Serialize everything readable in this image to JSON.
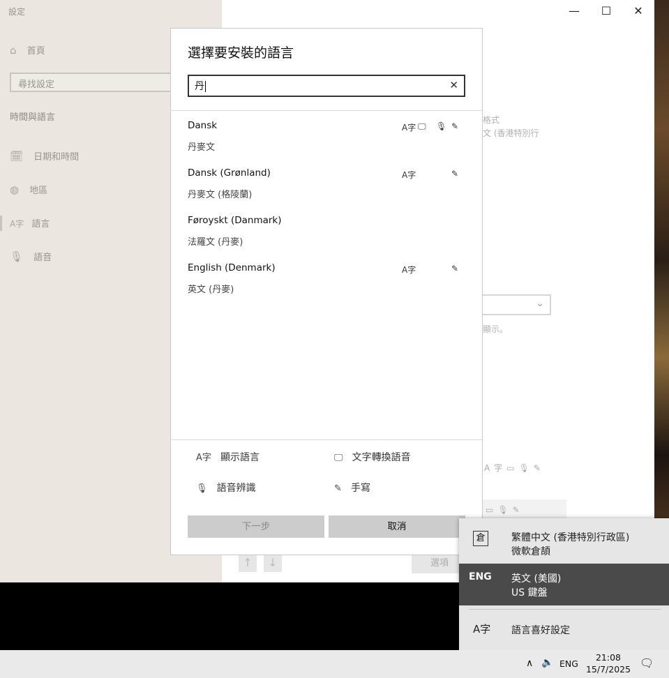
{
  "settings": {
    "title": "設定",
    "home": "首頁",
    "search_placeholder": "尋找設定",
    "section": "時間與語言",
    "nav": [
      {
        "label": "日期和時間",
        "icon": "calendar-clock-icon"
      },
      {
        "label": "地區",
        "icon": "globe-icon"
      },
      {
        "label": "語言",
        "icon": "language-icon"
      },
      {
        "label": "語音",
        "icon": "microphone-icon"
      }
    ],
    "bg_text_1": "格式",
    "bg_text_2": "文 (香港特別行",
    "bg_text_3": "顯示。",
    "bg_options_button": "選項"
  },
  "dialog": {
    "title": "選擇要安裝的語言",
    "search_value": "丹",
    "results": [
      {
        "name": "Dansk",
        "native": "丹麥文",
        "display_lang": true,
        "tts": true,
        "speech": true,
        "handwriting": true
      },
      {
        "name": "Dansk (Grønland)",
        "native": "丹麥文 (格陵蘭)",
        "display_lang": true,
        "tts": false,
        "speech": false,
        "handwriting": true
      },
      {
        "name": "Føroyskt (Danmark)",
        "native": "法羅文 (丹麥)",
        "display_lang": false,
        "tts": false,
        "speech": false,
        "handwriting": false
      },
      {
        "name": "English (Denmark)",
        "native": "英文 (丹麥)",
        "display_lang": true,
        "tts": false,
        "speech": false,
        "handwriting": true
      }
    ],
    "legend": {
      "display_language": "顯示語言",
      "text_to_speech": "文字轉換語音",
      "speech_recognition": "語音辨識",
      "handwriting": "手寫"
    },
    "next_button": "下一步",
    "cancel_button": "取消"
  },
  "flyout": {
    "items": [
      {
        "badge": "倉",
        "title": "繁體中文 (香港特別行政區)",
        "subtitle": "微軟倉頡"
      },
      {
        "badge": "ENG",
        "title": "英文 (美國)",
        "subtitle": "US 鍵盤"
      }
    ],
    "preferences": "語言喜好設定"
  },
  "taskbar": {
    "ime": "ENG",
    "time": "21:08",
    "date": "15/7/2025"
  },
  "colors": {
    "sidebar_bg": "#ebe7e0",
    "flyout_selected": "#4a4a4a",
    "button_gray": "#cccccc"
  }
}
